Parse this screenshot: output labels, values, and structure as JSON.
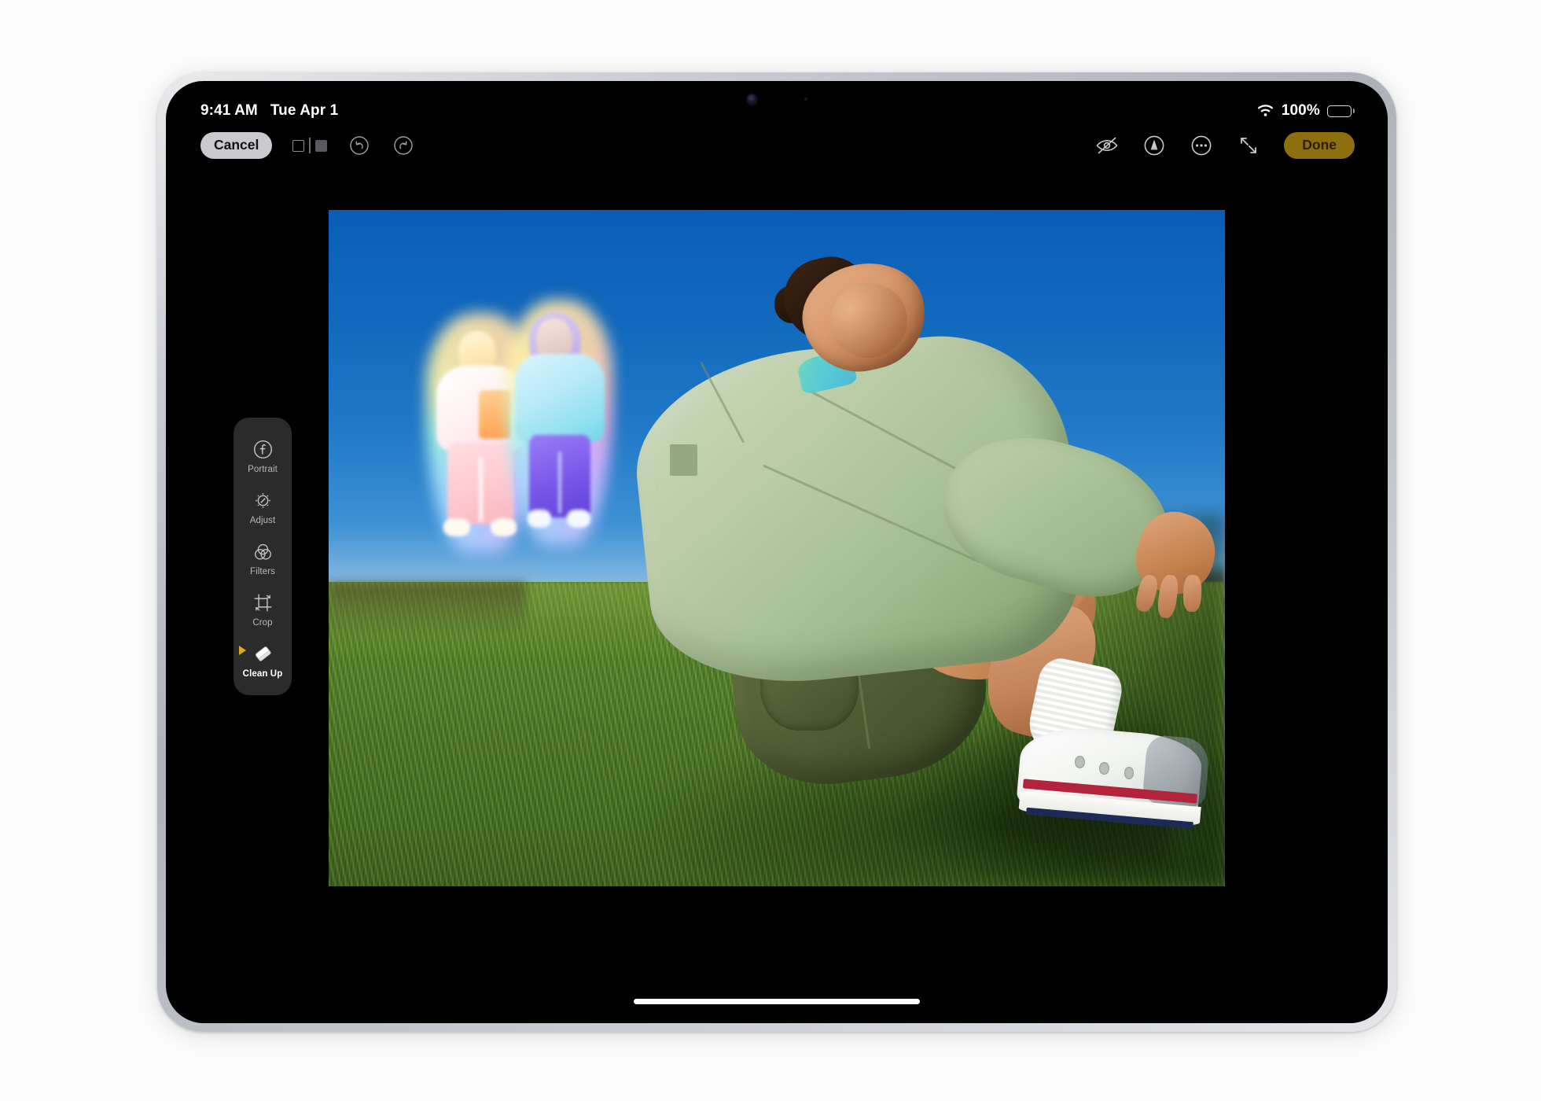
{
  "device": {
    "type": "tablet",
    "frame_color": "#b6babf",
    "screen_background": "#000000"
  },
  "status_bar": {
    "time": "9:41 AM",
    "date": "Tue Apr 1",
    "wifi_icon": "wifi-icon",
    "battery_percent": "100%",
    "battery_level": 100,
    "battery_icon": "battery-full-icon"
  },
  "top_toolbar": {
    "cancel_label": "Cancel",
    "done_label": "Done",
    "compare_toggle_name": "before-after-compare-toggle",
    "undo_icon": "undo-icon",
    "redo_icon": "redo-icon",
    "hide_edits_icon": "eye-slash-icon",
    "markup_icon": "markup-pen-icon",
    "more_icon": "ellipsis-circle-icon",
    "fullscreen_icon": "expand-arrows-icon",
    "accent_color": "#8d6f10",
    "cancel_bg": "#c9c9ce"
  },
  "edit_sidebar": {
    "panel_color": "#2b2b2b",
    "active_marker_color": "#e8a81c",
    "items": [
      {
        "label": "Portrait",
        "icon": "aperture-f-icon",
        "active": false
      },
      {
        "label": "Adjust",
        "icon": "adjust-dial-icon",
        "active": false
      },
      {
        "label": "Filters",
        "icon": "filters-circles-icon",
        "active": false
      },
      {
        "label": "Crop",
        "icon": "crop-rotate-icon",
        "active": false
      },
      {
        "label": "Clean Up",
        "icon": "eraser-icon",
        "active": true
      }
    ]
  },
  "photo": {
    "description": "Woman in sage green sweatshirt and olive cargo shorts sitting on sunlit grass under a deep blue sky",
    "sky_color": "#1169bd",
    "grass_color": "#4e7a27",
    "subject_top_color": "#a9c095",
    "subject_shorts_color": "#4c5a32",
    "cleanup_selection": {
      "label": "cleanup-highlighted-subjects",
      "count": 2,
      "highlight_style": "iridescent-glow-outline"
    }
  },
  "home_indicator": {
    "name": "home-indicator"
  }
}
